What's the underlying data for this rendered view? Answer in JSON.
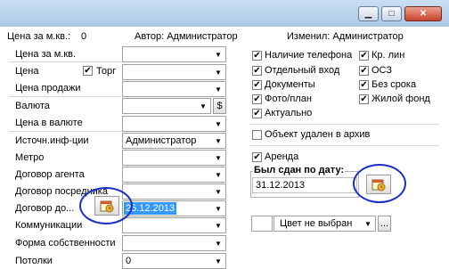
{
  "window": {
    "minimize_glyph": "▁",
    "maximize_glyph": "□",
    "close_glyph": "✕"
  },
  "header": {
    "price_label": "Цена за м.кв.:",
    "price_value": "0",
    "author": "Автор: Администратор",
    "modified": "Изменил: Администратор"
  },
  "left": {
    "price_sqm": "Цена за м.кв.",
    "price": "Цена",
    "trade": "Торг",
    "sale_price": "Цена продажи",
    "currency": "Валюта",
    "currency_btn": "$",
    "price_currency": "Цена в валюте",
    "source": "Источн.инф-ции",
    "source_value": "Администратор",
    "metro": "Метро",
    "agent_contract": "Договор агента",
    "broker_contract": "Договор посредника",
    "contract_to": "Договор до...",
    "contract_to_value": "25.12.2013",
    "utilities": "Коммуникации",
    "ownership": "Форма собственности",
    "ceilings": "Потолки",
    "ceilings_value": "0"
  },
  "checks": {
    "phone": "Наличие телефона",
    "separate_entrance": "Отдельный вход",
    "documents": "Документы",
    "photo_plan": "Фото/план",
    "actual": "Актуально",
    "kr_lin": "Кр. лин",
    "osz": "ОСЗ",
    "no_term": "Без срока",
    "residential": "Жилой фонд",
    "archived": "Объект удален в архив",
    "rent": "Аренда",
    "check_mark": "✔"
  },
  "rented": {
    "label": "Был сдан по дату:",
    "value": "31.12.2013"
  },
  "color": {
    "label": "Цвет не выбран",
    "more": "..."
  },
  "colors": {
    "annotation": "#1a2fc9",
    "selection": "#3399ff"
  }
}
